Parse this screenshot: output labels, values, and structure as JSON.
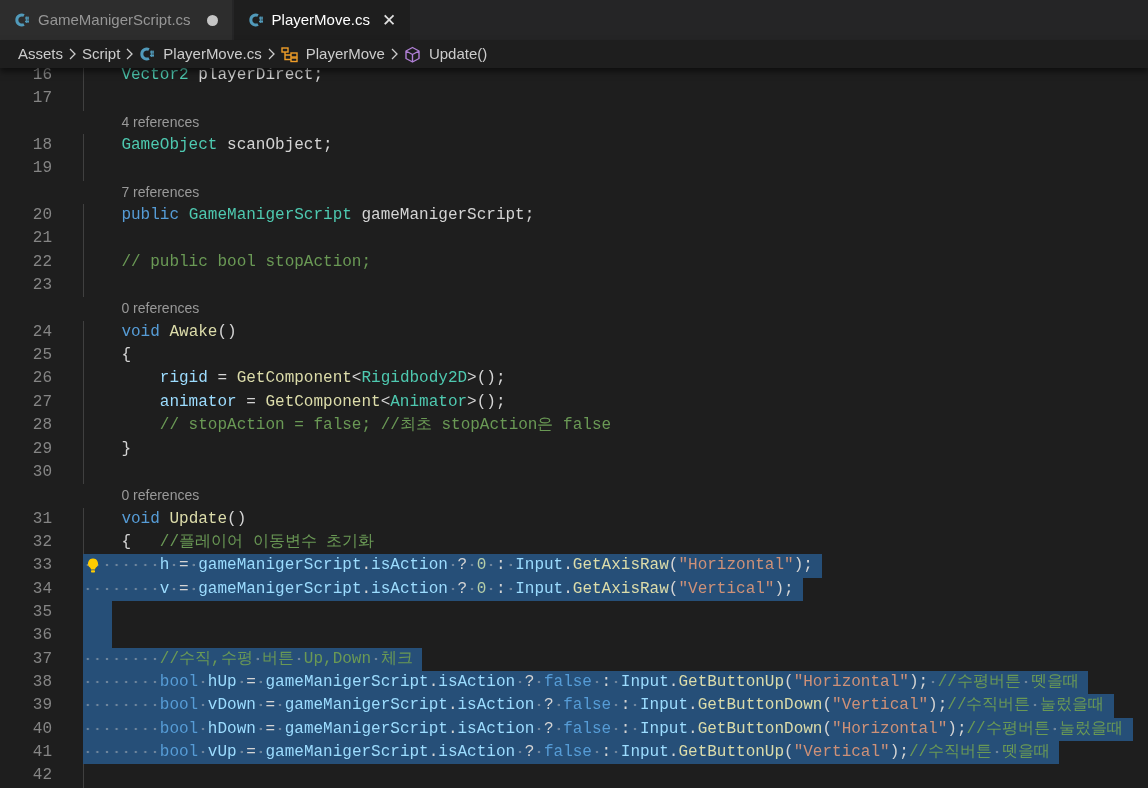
{
  "tabs": [
    {
      "label": "GameManigerScript.cs",
      "selected": false,
      "dirty": true
    },
    {
      "label": "PlayerMove.cs",
      "selected": true,
      "dirty": false,
      "close_glyph": "✕"
    }
  ],
  "breadcrumb": [
    {
      "kind": "folder",
      "label": "Assets"
    },
    {
      "kind": "folder",
      "label": "Script"
    },
    {
      "kind": "file",
      "label": "PlayerMove.cs"
    },
    {
      "kind": "class",
      "label": "PlayerMove"
    },
    {
      "kind": "method",
      "label": "Update()"
    }
  ],
  "lines": [
    {
      "number": "16",
      "selected": false,
      "lightbulb": false,
      "tokens": [
        {
          "kind": "type",
          "text": "    Vector2"
        },
        {
          "kind": "plain",
          "text": " playerDirect;"
        }
      ]
    },
    {
      "number": "17",
      "selected": false,
      "lightbulb": false
    },
    {
      "number": "18",
      "selected": false,
      "lightbulb": false,
      "references": "4 references",
      "tokens": [
        {
          "kind": "type",
          "text": "    GameObject"
        },
        {
          "kind": "plain",
          "text": " scanObject;"
        }
      ]
    },
    {
      "number": "19",
      "selected": false,
      "lightbulb": false
    },
    {
      "number": "20",
      "selected": false,
      "lightbulb": false,
      "references": "7 references",
      "tokens": [
        {
          "kind": "keyword",
          "text": "    public "
        },
        {
          "kind": "type",
          "text": "GameManigerScript"
        },
        {
          "kind": "plain",
          "text": " gameManigerScript;"
        }
      ]
    },
    {
      "number": "21",
      "selected": false,
      "lightbulb": false
    },
    {
      "number": "22",
      "selected": false,
      "lightbulb": false,
      "tokens": [
        {
          "kind": "comment",
          "text": "    // public bool stopAction;"
        }
      ]
    },
    {
      "number": "23",
      "selected": false,
      "lightbulb": false
    },
    {
      "number": "24",
      "selected": false,
      "lightbulb": false,
      "references": "0 references",
      "tokens": [
        {
          "kind": "keyword",
          "text": "    void "
        },
        {
          "kind": "func",
          "text": "Awake"
        },
        {
          "kind": "plain",
          "text": "()"
        }
      ]
    },
    {
      "number": "25",
      "selected": false,
      "lightbulb": false,
      "tokens": [
        {
          "kind": "plain",
          "text": "    {"
        }
      ]
    },
    {
      "number": "26",
      "selected": false,
      "lightbulb": false,
      "tokens": [
        {
          "kind": "var",
          "text": "        rigid"
        },
        {
          "kind": "plain",
          "text": " = "
        },
        {
          "kind": "func",
          "text": "GetComponent"
        },
        {
          "kind": "plain",
          "text": "<"
        },
        {
          "kind": "type",
          "text": "Rigidbody2D"
        },
        {
          "kind": "plain",
          "text": ">();"
        }
      ]
    },
    {
      "number": "27",
      "selected": false,
      "lightbulb": false,
      "tokens": [
        {
          "kind": "var",
          "text": "        animator"
        },
        {
          "kind": "plain",
          "text": " = "
        },
        {
          "kind": "func",
          "text": "GetComponent"
        },
        {
          "kind": "plain",
          "text": "<"
        },
        {
          "kind": "type",
          "text": "Animator"
        },
        {
          "kind": "plain",
          "text": ">();"
        }
      ]
    },
    {
      "number": "28",
      "selected": false,
      "lightbulb": false,
      "tokens": [
        {
          "kind": "comment",
          "text": "        // stopAction = false; //최초 stopAction은 false"
        }
      ]
    },
    {
      "number": "29",
      "selected": false,
      "lightbulb": false,
      "tokens": [
        {
          "kind": "plain",
          "text": "    }"
        }
      ]
    },
    {
      "number": "30",
      "selected": false,
      "lightbulb": false
    },
    {
      "number": "31",
      "selected": false,
      "lightbulb": false,
      "references": "0 references",
      "tokens": [
        {
          "kind": "keyword",
          "text": "    void "
        },
        {
          "kind": "func",
          "text": "Update"
        },
        {
          "kind": "plain",
          "text": "()"
        }
      ]
    },
    {
      "number": "32",
      "selected": false,
      "lightbulb": false,
      "tokens": [
        {
          "kind": "plain",
          "text": "    {   "
        },
        {
          "kind": "comment",
          "text": "//플레이어 이동변수 초기화"
        }
      ]
    },
    {
      "number": "33",
      "selected": true,
      "lightbulb": true,
      "tokens": [
        {
          "kind": "var",
          "text": "        h"
        },
        {
          "kind": "plain",
          "text": " = "
        },
        {
          "kind": "var",
          "text": "gameManigerScript"
        },
        {
          "kind": "plain",
          "text": "."
        },
        {
          "kind": "var",
          "text": "isAction"
        },
        {
          "kind": "plain",
          "text": " ? "
        },
        {
          "kind": "number",
          "text": "0"
        },
        {
          "kind": "plain",
          "text": " : "
        },
        {
          "kind": "var",
          "text": "Input"
        },
        {
          "kind": "plain",
          "text": "."
        },
        {
          "kind": "func",
          "text": "GetAxisRaw"
        },
        {
          "kind": "plain",
          "text": "("
        },
        {
          "kind": "string",
          "text": "\"Horizontal\""
        },
        {
          "kind": "plain",
          "text": ");"
        }
      ]
    },
    {
      "number": "34",
      "selected": true,
      "lightbulb": false,
      "tokens": [
        {
          "kind": "var",
          "text": "        v"
        },
        {
          "kind": "plain",
          "text": " = "
        },
        {
          "kind": "var",
          "text": "gameManigerScript"
        },
        {
          "kind": "plain",
          "text": "."
        },
        {
          "kind": "var",
          "text": "isAction"
        },
        {
          "kind": "plain",
          "text": " ? "
        },
        {
          "kind": "number",
          "text": "0"
        },
        {
          "kind": "plain",
          "text": " : "
        },
        {
          "kind": "var",
          "text": "Input"
        },
        {
          "kind": "plain",
          "text": "."
        },
        {
          "kind": "func",
          "text": "GetAxisRaw"
        },
        {
          "kind": "plain",
          "text": "("
        },
        {
          "kind": "string",
          "text": "\"Vertical\""
        },
        {
          "kind": "plain",
          "text": ");"
        }
      ]
    },
    {
      "number": "35",
      "selected": true,
      "lightbulb": false
    },
    {
      "number": "36",
      "selected": true,
      "lightbulb": false
    },
    {
      "number": "37",
      "selected": true,
      "lightbulb": false,
      "tokens": [
        {
          "kind": "comment",
          "text": "        //수직,수평 버튼 Up,Down 체크"
        }
      ]
    },
    {
      "number": "38",
      "selected": true,
      "lightbulb": false,
      "tokens": [
        {
          "kind": "keyword",
          "text": "        bool "
        },
        {
          "kind": "var",
          "text": "hUp"
        },
        {
          "kind": "plain",
          "text": " = "
        },
        {
          "kind": "var",
          "text": "gameManigerScript"
        },
        {
          "kind": "plain",
          "text": "."
        },
        {
          "kind": "var",
          "text": "isAction"
        },
        {
          "kind": "plain",
          "text": " ? "
        },
        {
          "kind": "keyword",
          "text": "false"
        },
        {
          "kind": "plain",
          "text": " : "
        },
        {
          "kind": "var",
          "text": "Input"
        },
        {
          "kind": "plain",
          "text": "."
        },
        {
          "kind": "func",
          "text": "GetButtonUp"
        },
        {
          "kind": "plain",
          "text": "("
        },
        {
          "kind": "string",
          "text": "\"Horizontal\""
        },
        {
          "kind": "plain",
          "text": "); "
        },
        {
          "kind": "comment",
          "text": "//수평버튼 뗏을때"
        }
      ]
    },
    {
      "number": "39",
      "selected": true,
      "lightbulb": false,
      "tokens": [
        {
          "kind": "keyword",
          "text": "        bool "
        },
        {
          "kind": "var",
          "text": "vDown"
        },
        {
          "kind": "plain",
          "text": " = "
        },
        {
          "kind": "var",
          "text": "gameManigerScript"
        },
        {
          "kind": "plain",
          "text": "."
        },
        {
          "kind": "var",
          "text": "isAction"
        },
        {
          "kind": "plain",
          "text": " ? "
        },
        {
          "kind": "keyword",
          "text": "false"
        },
        {
          "kind": "plain",
          "text": " : "
        },
        {
          "kind": "var",
          "text": "Input"
        },
        {
          "kind": "plain",
          "text": "."
        },
        {
          "kind": "func",
          "text": "GetButtonDown"
        },
        {
          "kind": "plain",
          "text": "("
        },
        {
          "kind": "string",
          "text": "\"Vertical\""
        },
        {
          "kind": "plain",
          "text": ");"
        },
        {
          "kind": "comment",
          "text": "//수직버튼 눌렀을때"
        }
      ]
    },
    {
      "number": "40",
      "selected": true,
      "lightbulb": false,
      "tokens": [
        {
          "kind": "keyword",
          "text": "        bool "
        },
        {
          "kind": "var",
          "text": "hDown"
        },
        {
          "kind": "plain",
          "text": " = "
        },
        {
          "kind": "var",
          "text": "gameManigerScript"
        },
        {
          "kind": "plain",
          "text": "."
        },
        {
          "kind": "var",
          "text": "isAction"
        },
        {
          "kind": "plain",
          "text": " ? "
        },
        {
          "kind": "keyword",
          "text": "false"
        },
        {
          "kind": "plain",
          "text": " : "
        },
        {
          "kind": "var",
          "text": "Input"
        },
        {
          "kind": "plain",
          "text": "."
        },
        {
          "kind": "func",
          "text": "GetButtonDown"
        },
        {
          "kind": "plain",
          "text": "("
        },
        {
          "kind": "string",
          "text": "\"Horizontal\""
        },
        {
          "kind": "plain",
          "text": ");"
        },
        {
          "kind": "comment",
          "text": "//수평버튼 눌렀을때"
        }
      ]
    },
    {
      "number": "41",
      "selected": true,
      "lightbulb": false,
      "tokens": [
        {
          "kind": "keyword",
          "text": "        bool "
        },
        {
          "kind": "var",
          "text": "vUp"
        },
        {
          "kind": "plain",
          "text": " = "
        },
        {
          "kind": "var",
          "text": "gameManigerScript"
        },
        {
          "kind": "plain",
          "text": "."
        },
        {
          "kind": "var",
          "text": "isAction"
        },
        {
          "kind": "plain",
          "text": " ? "
        },
        {
          "kind": "keyword",
          "text": "false"
        },
        {
          "kind": "plain",
          "text": " : "
        },
        {
          "kind": "var",
          "text": "Input"
        },
        {
          "kind": "plain",
          "text": "."
        },
        {
          "kind": "func",
          "text": "GetButtonUp"
        },
        {
          "kind": "plain",
          "text": "("
        },
        {
          "kind": "string",
          "text": "\"Vertical\""
        },
        {
          "kind": "plain",
          "text": ");"
        },
        {
          "kind": "comment",
          "text": "//수직버튼 뗏을때"
        }
      ]
    },
    {
      "number": "42",
      "selected": false,
      "lightbulb": false
    }
  ]
}
